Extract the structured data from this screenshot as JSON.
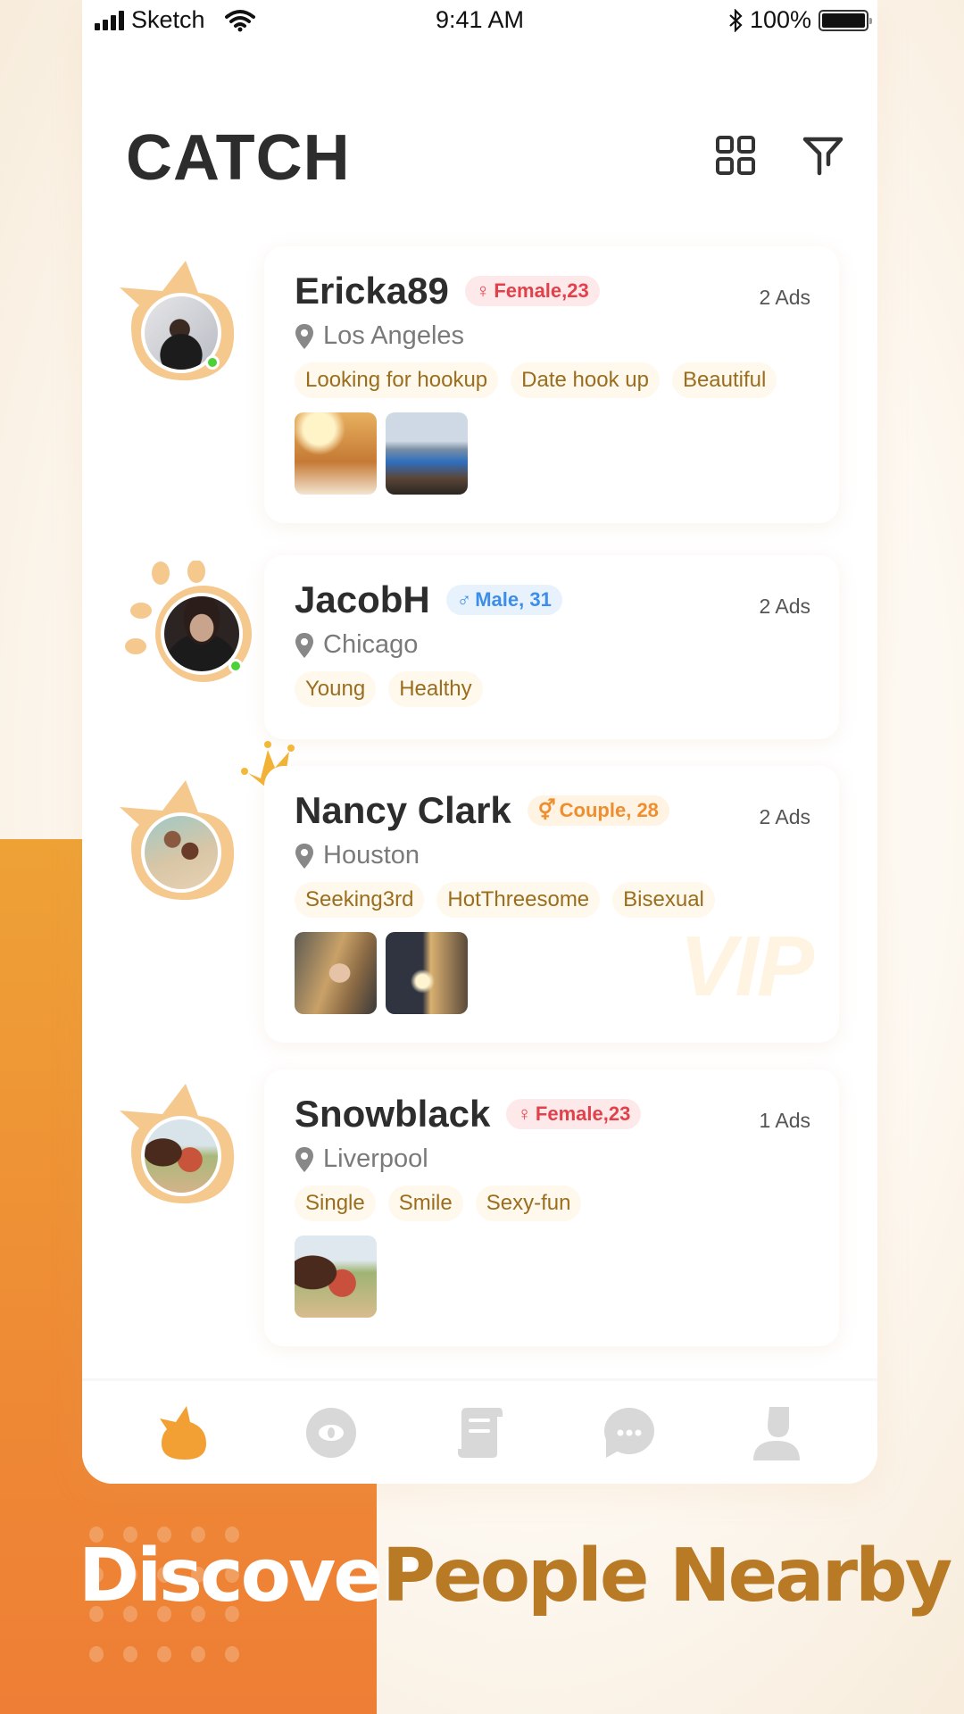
{
  "status_bar": {
    "carrier": "Sketch",
    "time": "9:41 AM",
    "battery": "100%",
    "icons": [
      "signal-icon",
      "wifi-icon",
      "bluetooth-icon",
      "battery-icon"
    ]
  },
  "header": {
    "title": "CATCH",
    "grid_icon": "grid-view-icon",
    "filter_icon": "filter-icon"
  },
  "colors": {
    "accent": "#F2A034",
    "avatar_blob": "#F5C88E",
    "female": "#E0414A",
    "male": "#3C8EE8",
    "couple": "#EE8E2E",
    "tag_text": "#9A6E1E",
    "online": "#4CD137"
  },
  "profiles": [
    {
      "name": "Ericka89",
      "gender_symbol": "♀",
      "gender_label": "Female,23",
      "gender_type": "female",
      "ads": "2 Ads",
      "location": "Los Angeles",
      "tags": [
        "Looking for hookup",
        "Date hook up",
        "Beautiful"
      ],
      "photo_count": 2,
      "online": true,
      "vip": false
    },
    {
      "name": "JacobH",
      "gender_symbol": "♂",
      "gender_label": "Male, 31",
      "gender_type": "male",
      "ads": "2 Ads",
      "location": "Chicago",
      "tags": [
        "Young",
        "Healthy"
      ],
      "photo_count": 0,
      "online": true,
      "vip": false
    },
    {
      "name": "Nancy Clark",
      "gender_symbol": "⚥",
      "gender_label": "Couple, 28",
      "gender_type": "couple",
      "ads": "2 Ads",
      "location": "Houston",
      "tags": [
        "Seeking3rd",
        "HotThreesome",
        "Bisexual"
      ],
      "photo_count": 2,
      "online": false,
      "vip": true,
      "vip_label": "VIP"
    },
    {
      "name": "Snowblack",
      "gender_symbol": "♀",
      "gender_label": "Female,23",
      "gender_type": "female",
      "ads": "1 Ads",
      "location": "Liverpool",
      "tags": [
        "Single",
        "Smile",
        "Sexy-fun"
      ],
      "photo_count": 1,
      "online": false,
      "vip": false
    }
  ],
  "tab_bar": {
    "tabs": [
      {
        "name": "catch",
        "icon": "catch-flame-icon",
        "active": true
      },
      {
        "name": "discover",
        "icon": "eye-icon",
        "active": false
      },
      {
        "name": "ads",
        "icon": "scroll-icon",
        "active": false
      },
      {
        "name": "messages",
        "icon": "chat-bubble-icon",
        "active": false
      },
      {
        "name": "profile",
        "icon": "person-icon",
        "active": false
      }
    ]
  },
  "slogan": {
    "part1": "Discover",
    "part2": "People Nearby"
  }
}
